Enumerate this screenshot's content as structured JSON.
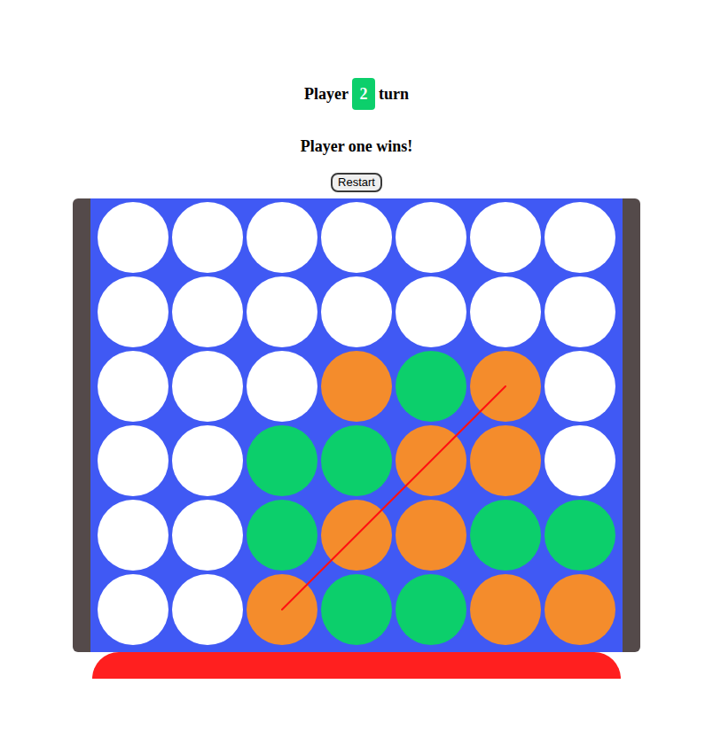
{
  "status": {
    "prefix": "Player",
    "player": "2",
    "suffix": "turn"
  },
  "players": [
    {
      "id": "1",
      "color": "#f48c2c"
    },
    {
      "id": "2",
      "color": "#0ccf6b"
    }
  ],
  "message": "Player one wins!",
  "restart": "Restart",
  "board": {
    "rows": [
      [
        0,
        0,
        0,
        0,
        0,
        0,
        0
      ],
      [
        0,
        0,
        0,
        0,
        0,
        0,
        0
      ],
      [
        0,
        0,
        0,
        1,
        2,
        1,
        0
      ],
      [
        0,
        0,
        2,
        2,
        1,
        1,
        0
      ],
      [
        0,
        0,
        2,
        1,
        1,
        2,
        2
      ],
      [
        0,
        0,
        1,
        2,
        2,
        1,
        1
      ]
    ]
  },
  "win_line": {
    "shown": true,
    "cells": [
      [
        5,
        2
      ],
      [
        4,
        3
      ],
      [
        3,
        4
      ],
      [
        2,
        5
      ]
    ]
  }
}
